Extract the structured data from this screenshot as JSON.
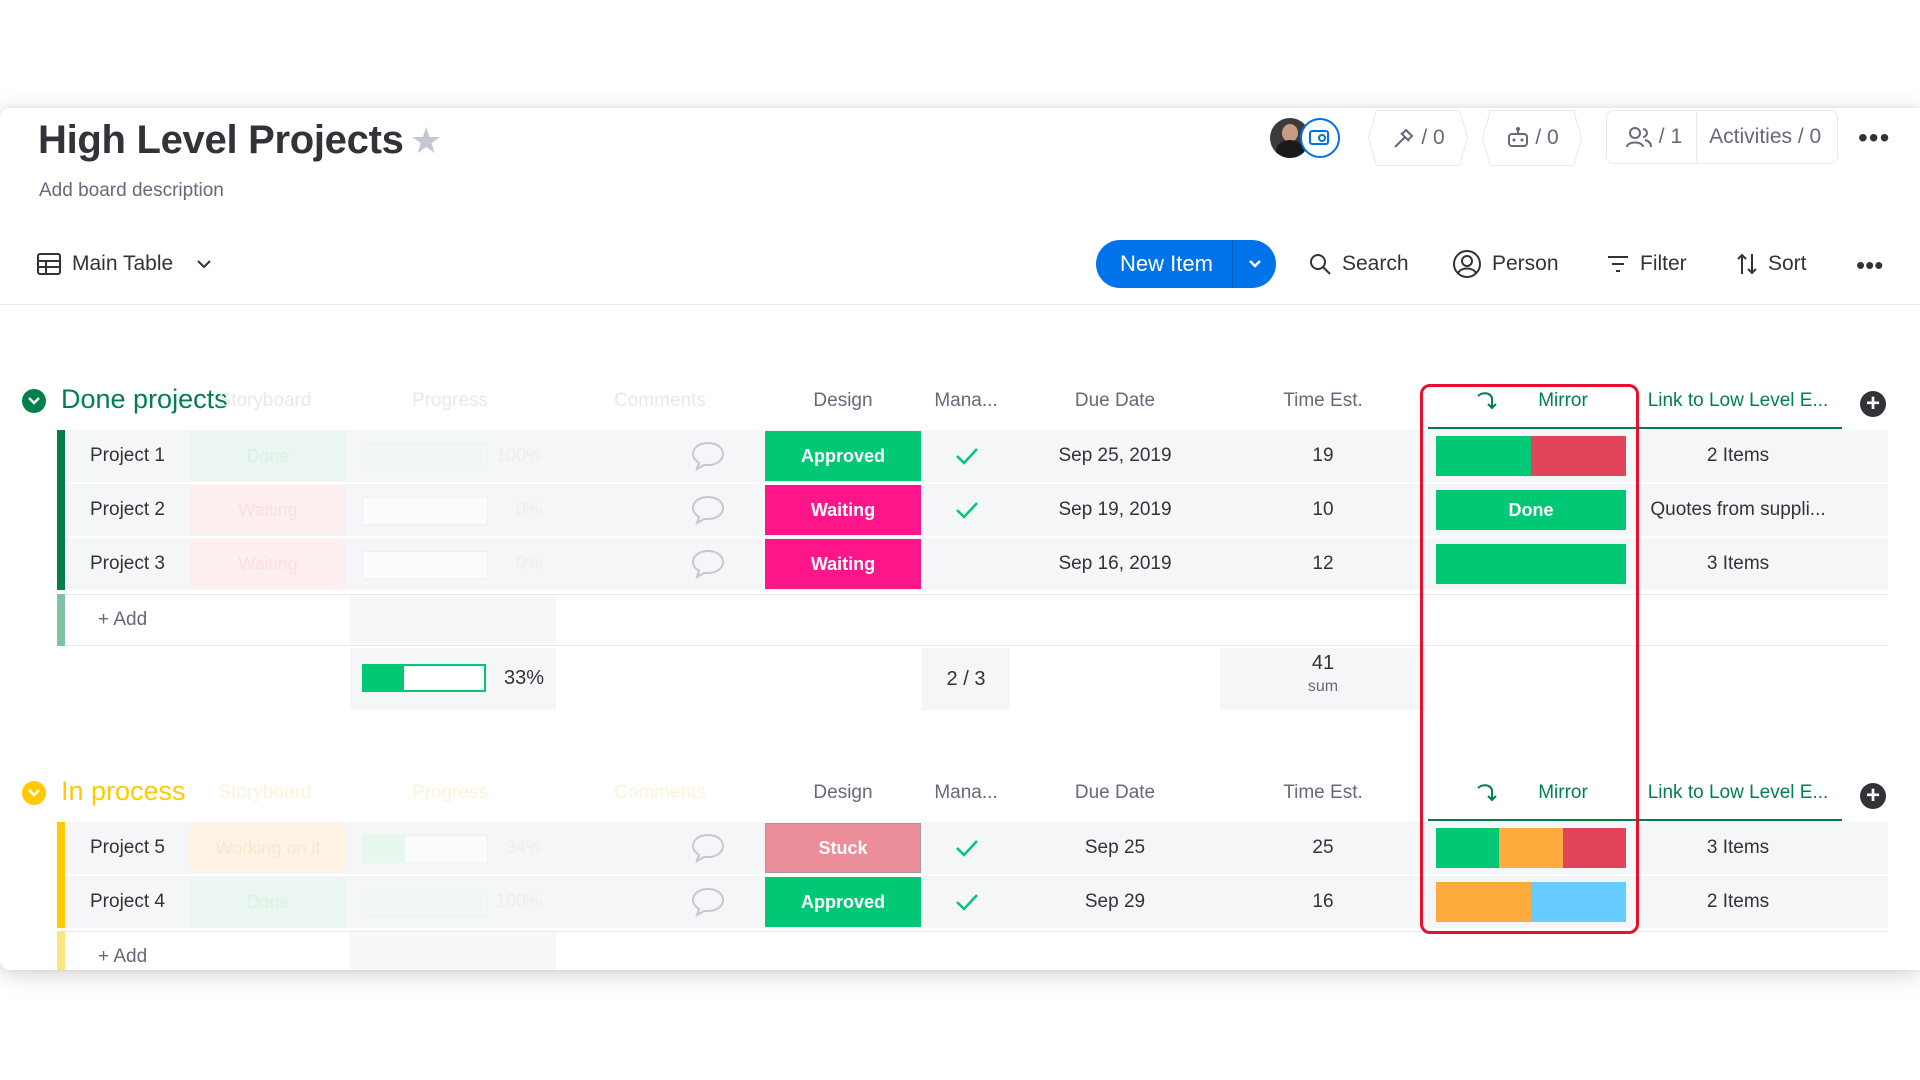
{
  "board": {
    "title": "High Level Projects",
    "description": "Add board description"
  },
  "header": {
    "integrations_count": "/ 0",
    "automations_count": "/ 0",
    "members_count": "/ 1",
    "activities_label": "Activities / 0"
  },
  "toolbar": {
    "view_label": "Main Table",
    "new_item_label": "New Item",
    "search_label": "Search",
    "person_label": "Person",
    "filter_label": "Filter",
    "sort_label": "Sort"
  },
  "columns": {
    "storyboard": "Storyboard",
    "progress": "Progress",
    "comments": "Comments",
    "design": "Design",
    "manager": "Mana...",
    "due_date": "Due Date",
    "time_est": "Time Est.",
    "mirror": "Mirror",
    "link": "Link to Low Level E..."
  },
  "groups": [
    {
      "name": "Done projects",
      "color": "#037f4c",
      "add_label": "+ Add",
      "rows": [
        {
          "name": "Project 1",
          "storyboard": "Done",
          "progress": "100%",
          "design": "Approved",
          "design_color": "#00c875",
          "manager_check": true,
          "due": "Sep 25, 2019",
          "time": "19",
          "link": "2 Items"
        },
        {
          "name": "Project 2",
          "storyboard": "Waiting",
          "progress": "0%",
          "design": "Waiting",
          "design_color": "#ff158a",
          "manager_check": true,
          "due": "Sep 19, 2019",
          "time": "10",
          "mirror_label": "Done",
          "link": "Quotes from suppli..."
        },
        {
          "name": "Project 3",
          "storyboard": "Waiting",
          "progress": "0%",
          "design": "Waiting",
          "design_color": "#ff158a",
          "manager_check": false,
          "due": "Sep 16, 2019",
          "time": "12",
          "link": "3 Items"
        }
      ],
      "summary": {
        "progress": "33%",
        "progress_fraction": 0.33,
        "manager": "2 / 3",
        "time_sum": "41",
        "time_sum_label": "sum"
      }
    },
    {
      "name": "In process",
      "color": "#ffcb00",
      "add_label": "+ Add",
      "rows": [
        {
          "name": "Project 5",
          "storyboard": "Working on it",
          "progress": "34%",
          "design": "Stuck",
          "design_color": "#e2445c",
          "manager_check": true,
          "due": "Sep 25",
          "time": "25",
          "link": "3 Items"
        },
        {
          "name": "Project 4",
          "storyboard": "Done",
          "progress": "100%",
          "design": "Approved",
          "design_color": "#00c875",
          "manager_check": true,
          "due": "Sep 29",
          "time": "16",
          "link": "2 Items"
        }
      ]
    }
  ],
  "colors": {
    "accent": "#0073ea",
    "green": "#00c875",
    "red": "#e2445c",
    "orange": "#fdab3d",
    "blue": "#66ccff",
    "pink": "#ff158a",
    "highlight": "#e8102d"
  }
}
